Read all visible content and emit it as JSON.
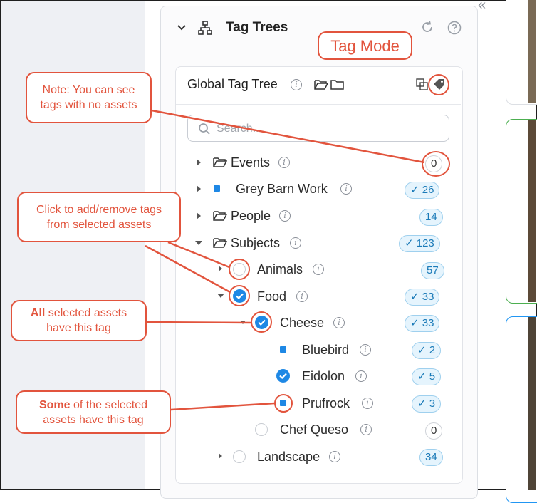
{
  "panel": {
    "title": "Tag Trees",
    "collapse_arrows": "«"
  },
  "tree": {
    "title": "Global Tag Tree",
    "search_placeholder": "Search..."
  },
  "rows": [
    {
      "label": "Events",
      "count": "0"
    },
    {
      "label": "Grey Barn Work",
      "count": "26"
    },
    {
      "label": "People",
      "count": "14"
    },
    {
      "label": "Subjects",
      "count": "123"
    },
    {
      "label": "Animals",
      "count": "57"
    },
    {
      "label": "Food",
      "count": "33"
    },
    {
      "label": "Cheese",
      "count": "33"
    },
    {
      "label": "Bluebird",
      "count": "2"
    },
    {
      "label": "Eidolon",
      "count": "5"
    },
    {
      "label": "Prufrock",
      "count": "3"
    },
    {
      "label": "Chef Queso",
      "count": "0"
    },
    {
      "label": "Landscape",
      "count": "34"
    }
  ],
  "callouts": {
    "tag_mode": "Tag Mode",
    "note_line1": "Note: You can see",
    "note_line2": "tags with no assets",
    "click_line1": "Click to add/remove tags",
    "click_line2": "from selected assets",
    "all_bold": "All",
    "all_rest": " selected assets",
    "all_line2": "have this tag",
    "some_bold": "Some",
    "some_rest": " of the selected",
    "some_line2": "assets have this tag"
  },
  "colors": {
    "accent": "#1e88e5",
    "annotation": "#e2543d",
    "badge_bg": "#e5f4fd",
    "badge_text": "#1a7ab8"
  }
}
